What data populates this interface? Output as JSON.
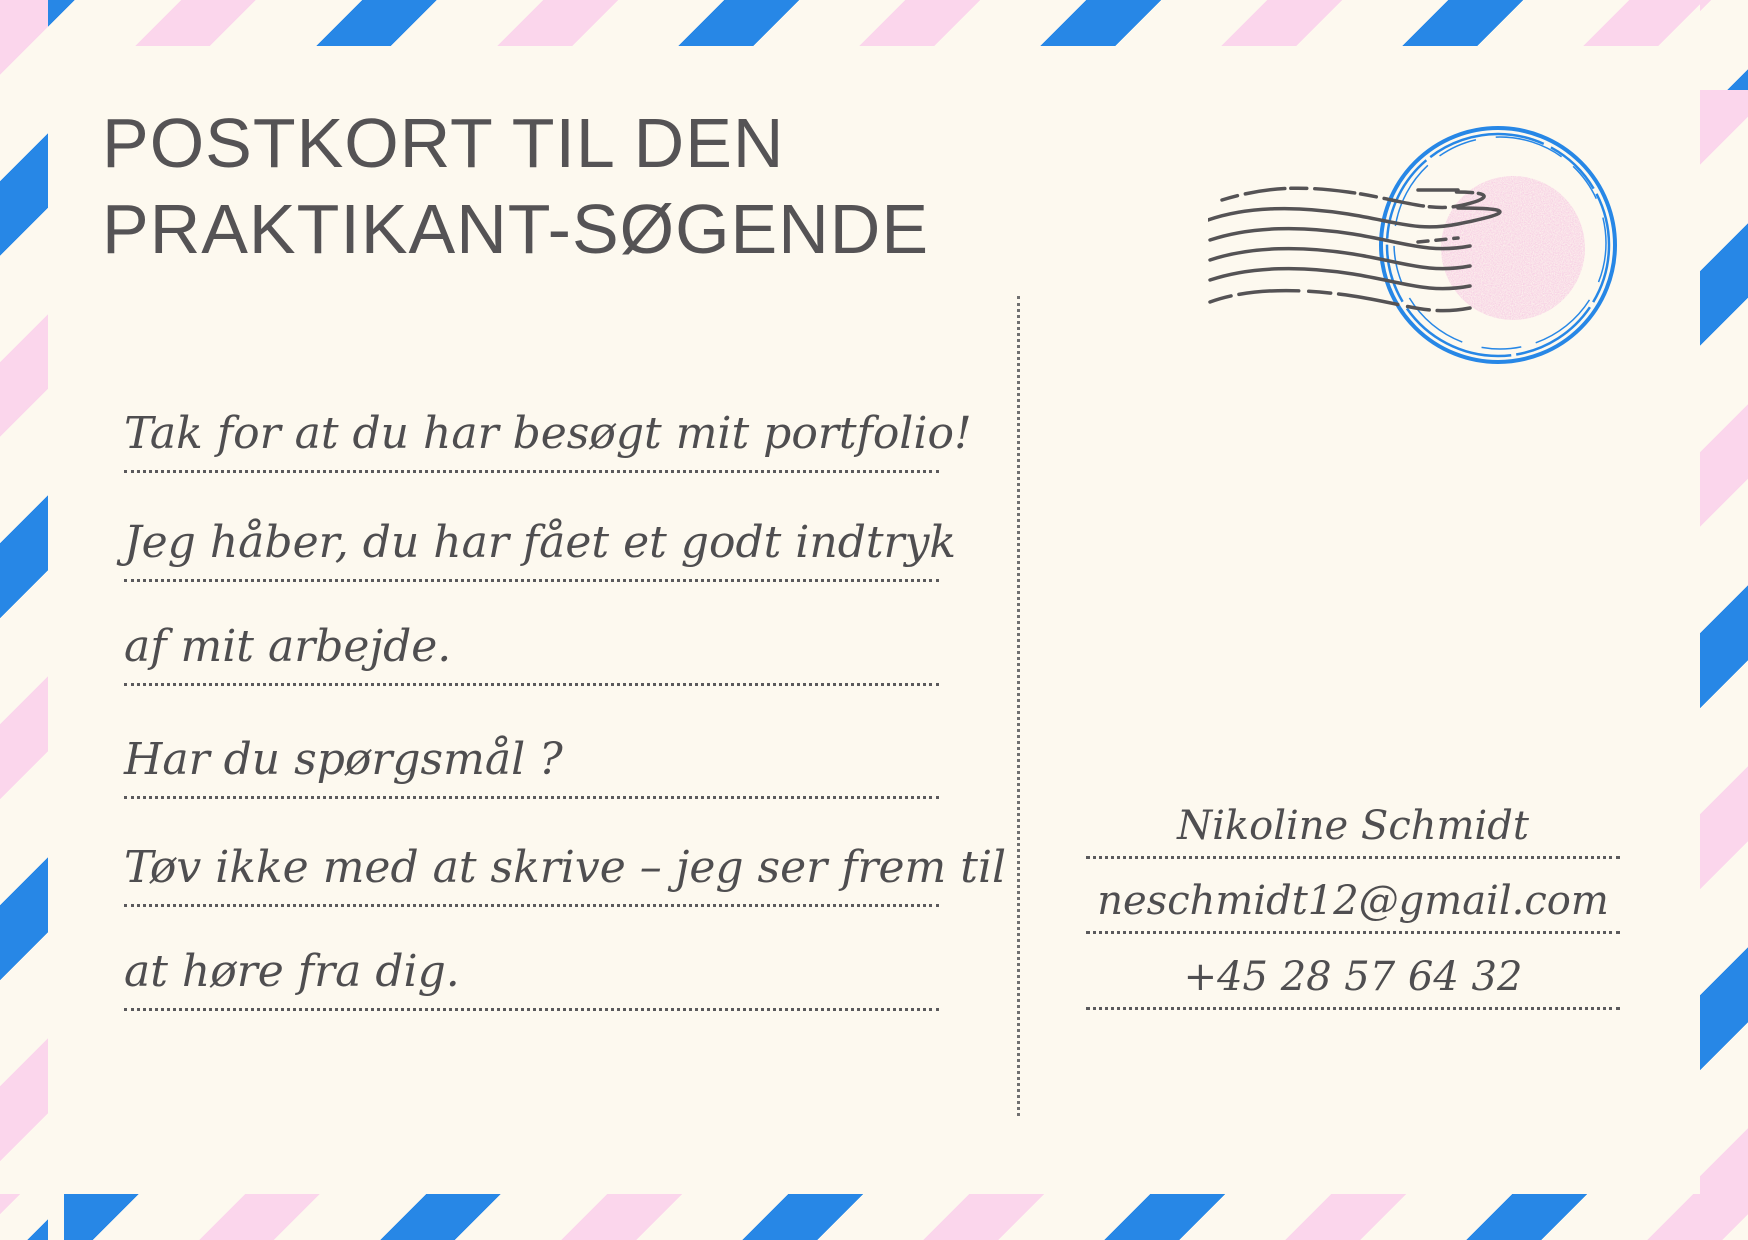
{
  "postcard": {
    "title_line1": "POSTKORT TIL DEN",
    "title_line2": "PRAKTIKANT-SØGENDE",
    "message_lines": [
      "Tak for at du har besøgt mit portfolio!",
      "Jeg håber, du har fået et godt indtryk",
      "af mit arbejde.",
      "Har du spørgsmål ?",
      "Tøv ikke med at skrive – jeg ser frem til",
      "at høre fra dig."
    ],
    "address": {
      "name": "Nikoline Schmidt",
      "email": "neschmidt12@gmail.com",
      "phone": "+45 28 57 64 32"
    },
    "postmark_icon": "postmark-stamp-icon"
  },
  "colors": {
    "background": "#fdf9ef",
    "stripe_blue": "#2787e6",
    "stripe_pink": "#fbd6ec",
    "text": "#555355"
  }
}
